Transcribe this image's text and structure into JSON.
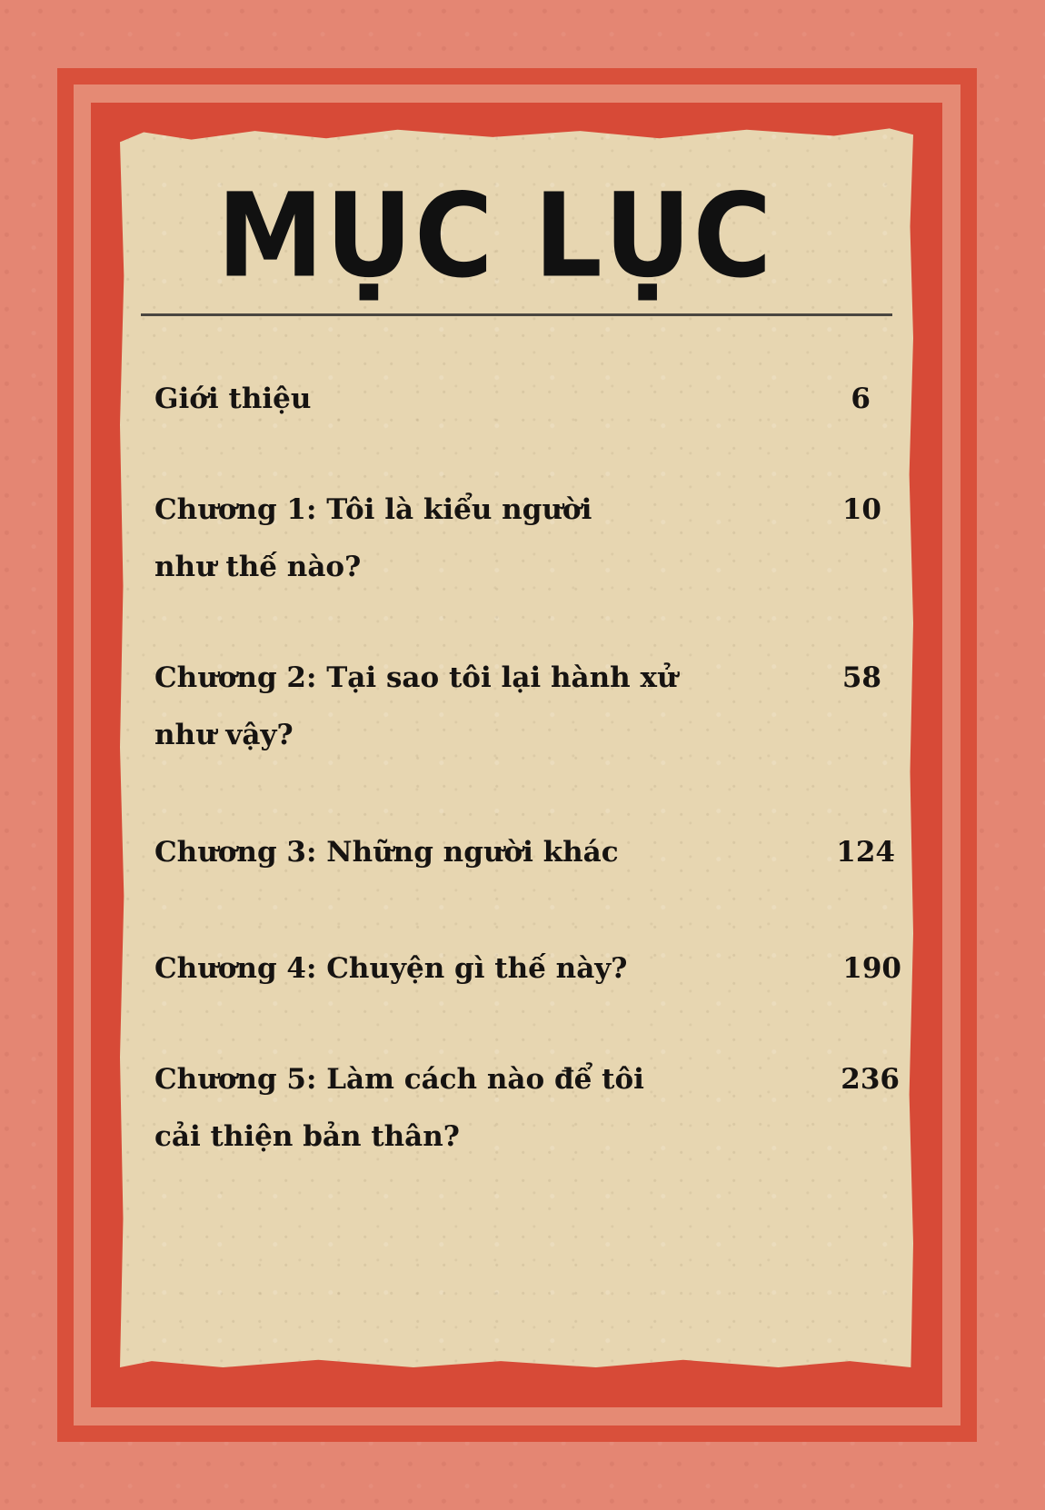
{
  "title": "MỤC LỤC",
  "entries": [
    {
      "title": "Giới thiệu",
      "page": "6"
    },
    {
      "title": "Chương 1: Tôi là kiểu người như thế nào?",
      "page": "10"
    },
    {
      "title": "Chương 2: Tại sao tôi lại hành xử như vậy?",
      "page": "58"
    },
    {
      "title": "Chương 3: Những người khác",
      "page": "124"
    },
    {
      "title": "Chương 4: Chuyện gì thế này?",
      "page": "190"
    },
    {
      "title": "Chương 5: Làm cách nào để tôi cải thiện bản thân?",
      "page": "236"
    }
  ],
  "colors": {
    "background": "#e48673",
    "frame": "#d9503b",
    "paper": "#e7d6b1",
    "text": "#161311"
  }
}
